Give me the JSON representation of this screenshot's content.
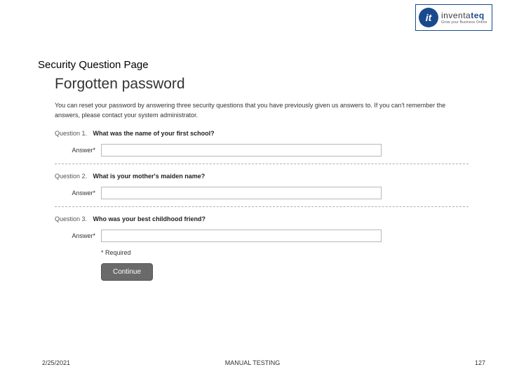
{
  "logo": {
    "mark": "it",
    "brand_prefix": "inventa",
    "brand_suffix": "teq",
    "tagline": "Grow your Business Online"
  },
  "slide": {
    "title": "Security Question Page"
  },
  "form": {
    "heading": "Forgotten password",
    "description": "You can reset your password by answering three security questions that you have previously given us answers to. If you can't remember the answers, please contact your system administrator.",
    "questions": [
      {
        "label": "Question 1.",
        "text": "What was the name of your first school?",
        "answer_label": "Answer*",
        "value": ""
      },
      {
        "label": "Question 2.",
        "text": "What is your mother's maiden name?",
        "answer_label": "Answer*",
        "value": ""
      },
      {
        "label": "Question 3.",
        "text": "Who was your best childhood friend?",
        "answer_label": "Answer*",
        "value": ""
      }
    ],
    "required_note": "* Required",
    "continue_label": "Continue"
  },
  "footer": {
    "date": "2/25/2021",
    "center": "MANUAL TESTING",
    "page": "127"
  }
}
